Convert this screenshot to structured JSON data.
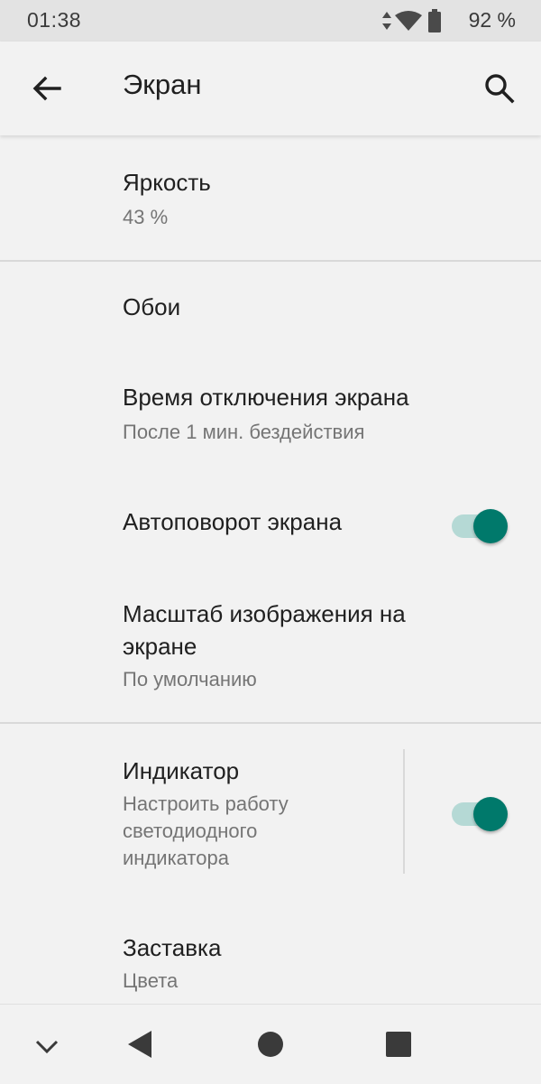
{
  "status_bar": {
    "time": "01:38",
    "battery_text": "92 %",
    "icons": [
      "data-arrows-icon",
      "wifi-icon",
      "battery-icon"
    ]
  },
  "app_bar": {
    "title": "Экран",
    "back_icon": "arrow-back-icon",
    "search_icon": "search-icon"
  },
  "settings": [
    {
      "id": "brightness",
      "title": "Яркость",
      "summary": "43 %"
    },
    {
      "id": "wallpaper",
      "title": "Обои"
    },
    {
      "id": "screen-timeout",
      "title": "Время отключения экрана",
      "summary": "После 1 мин. бездействия"
    },
    {
      "id": "auto-rotate",
      "title": "Автоповорот экрана",
      "toggle": true
    },
    {
      "id": "display-size",
      "title_line1": "Масштаб изображения на",
      "title_line2": "экране",
      "summary": "По умолчанию"
    },
    {
      "id": "indicator",
      "title": "Индикатор",
      "summary_line1": "Настроить работу",
      "summary_line2": "светодиодного",
      "summary_line3": "индикатора",
      "toggle": true
    },
    {
      "id": "screensaver",
      "title": "Заставка",
      "summary": "Цвета"
    }
  ],
  "nav_bar": {
    "icons": [
      "chevron-down-icon",
      "back-triangle-icon",
      "home-circle-icon",
      "recents-square-icon"
    ]
  },
  "colors": {
    "accent": "#00796b",
    "accent_track": "#b5d9d5",
    "background": "#f2f2f2",
    "status_bar": "#e3e3e3"
  }
}
